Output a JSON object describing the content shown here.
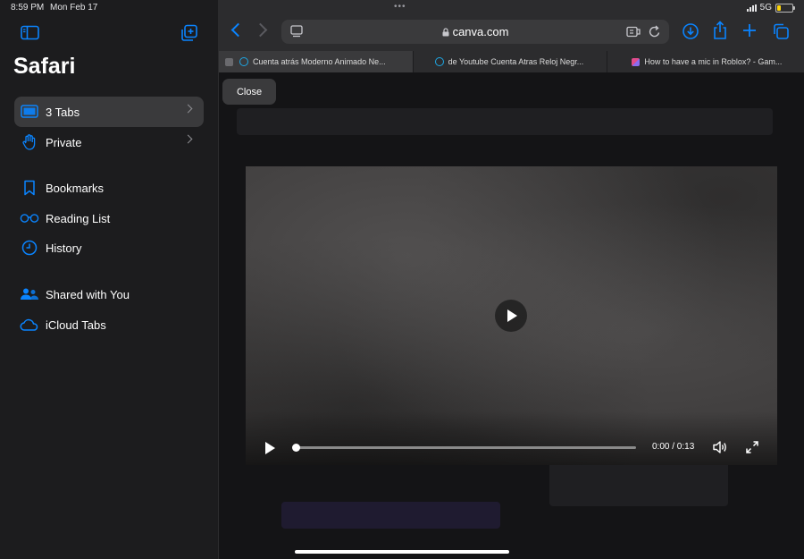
{
  "status_bar": {
    "time": "8:59 PM",
    "date": "Mon Feb 17",
    "network": "5G"
  },
  "sidebar": {
    "title": "Safari",
    "items": [
      {
        "label": "3 Tabs",
        "icon": "tabs-icon",
        "active": true
      },
      {
        "label": "Private",
        "icon": "hand-icon"
      },
      {
        "label": "Bookmarks",
        "icon": "bookmark-icon"
      },
      {
        "label": "Reading List",
        "icon": "glasses-icon"
      },
      {
        "label": "History",
        "icon": "clock-icon"
      },
      {
        "label": "Shared with You",
        "icon": "shared-people-icon"
      },
      {
        "label": "iCloud Tabs",
        "icon": "cloud-icon"
      }
    ]
  },
  "toolbar": {
    "url": "canva.com"
  },
  "tabs": [
    {
      "title": "Cuenta atrás Moderno Animado Ne..."
    },
    {
      "title": "de Youtube Cuenta Atras Reloj Negr..."
    },
    {
      "title": "How to have a mic in Roblox? - Gam..."
    }
  ],
  "overlay": {
    "close_label": "Close"
  },
  "video": {
    "time": "0:00 / 0:13",
    "progress": 0.0
  },
  "colors": {
    "accent": "#0a84ff",
    "sidebar_bg": "#1c1c1e",
    "active_row": "#3a3a3c"
  }
}
